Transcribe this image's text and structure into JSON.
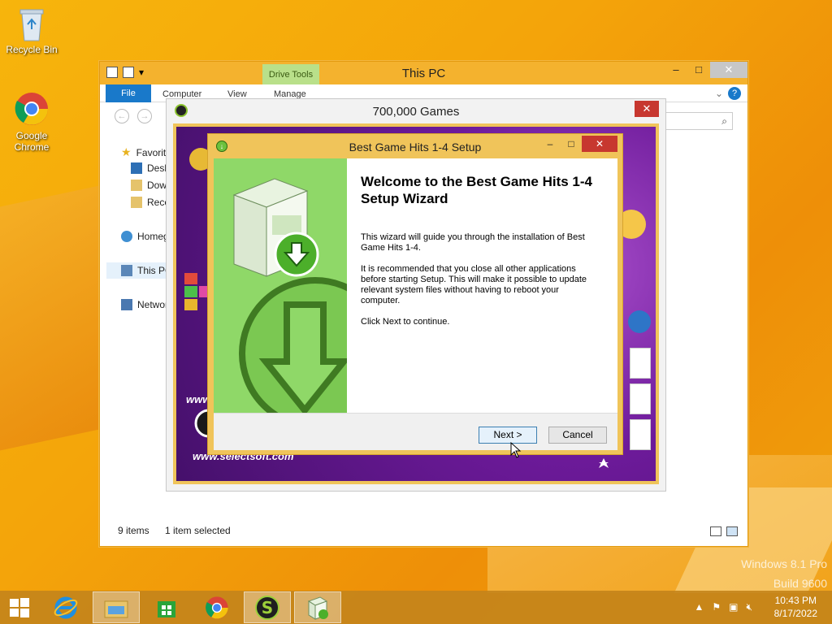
{
  "desktop": {
    "icons": [
      {
        "label": "Recycle Bin"
      },
      {
        "label": "Google Chrome"
      }
    ],
    "watermark": {
      "line1": "Windows 8.1 Pro",
      "line2": "Build 9600"
    }
  },
  "explorer": {
    "title": "This PC",
    "contextual_tab": "Drive Tools",
    "ribbon_tabs": {
      "file": "File",
      "computer": "Computer",
      "view": "View",
      "manage": "Manage"
    },
    "nav": {
      "favorites": "Favorites",
      "desktop": "Desktop",
      "downloads": "Downloads",
      "recent": "Recent places",
      "homegroup": "Homegroup",
      "this_pc": "This PC",
      "network": "Network"
    },
    "status": {
      "items": "9 items",
      "selected": "1 item selected"
    }
  },
  "game_window": {
    "title": "700,000 Games",
    "url_text_1": "www.",
    "url_text_2": "www.selectsoft.com"
  },
  "setup": {
    "title": "Best Game Hits 1-4 Setup",
    "heading": "Welcome to the Best Game Hits 1-4 Setup Wizard",
    "para1": "This wizard will guide you through the installation of Best Game Hits 1-4.",
    "para2": "It is recommended that you close all other applications before starting Setup. This will make it possible to update relevant system files without having to reboot your computer.",
    "para3": "Click Next to continue.",
    "next_label": "Next >",
    "cancel_label": "Cancel"
  },
  "taskbar": {
    "time": "10:43 PM",
    "date": "8/17/2022"
  },
  "colors": {
    "accent_blue": "#1979ca",
    "close_red": "#c7372f",
    "setup_green": "#8fd868"
  }
}
